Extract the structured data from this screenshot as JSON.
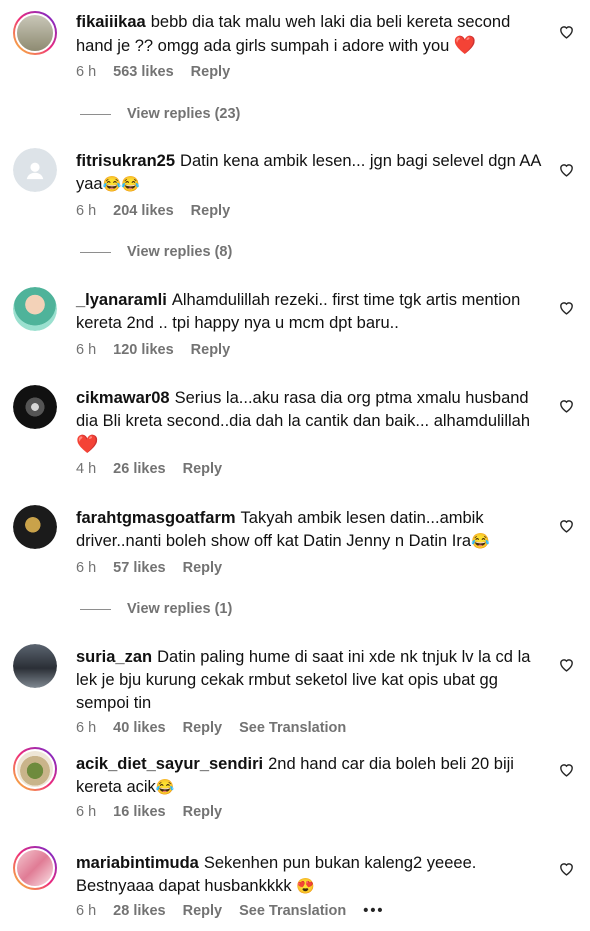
{
  "comments": [
    {
      "username": "fikaiiikaa",
      "text": "bebb dia tak malu weh laki dia beli kereta second hand je ?? omgg ada girls sumpah i adore with you",
      "emoji": "❤️",
      "time": "6 h",
      "likes": "563 likes",
      "reply": "Reply",
      "view_replies": "View replies (23)"
    },
    {
      "username": "fitrisukran25",
      "text": "Datin kena ambik lesen... jgn bagi selevel dgn AA yaa",
      "emoji": "😂😂",
      "time": "6 h",
      "likes": "204 likes",
      "reply": "Reply",
      "view_replies": "View replies (8)"
    },
    {
      "username": "_lyanaramli",
      "text": "Alhamdulillah rezeki.. first time tgk artis mention kereta 2nd .. tpi happy nya u mcm dpt baru..",
      "time": "6 h",
      "likes": "120 likes",
      "reply": "Reply"
    },
    {
      "username": "cikmawar08",
      "text": "Serius la...aku rasa dia org ptma xmalu husband dia Bli kreta second..dia dah la cantik dan baik... alhamdulillah",
      "emoji": "❤️",
      "time": "4 h",
      "likes": "26 likes",
      "reply": "Reply"
    },
    {
      "username": "farahtgmasgoatfarm",
      "text": "Takyah ambik lesen datin...ambik driver..nanti boleh show off kat Datin Jenny n Datin Ira",
      "emoji": "😂",
      "time": "6 h",
      "likes": "57 likes",
      "reply": "Reply",
      "view_replies": "View replies (1)"
    },
    {
      "username": "suria_zan",
      "text": "Datin paling hume di saat ini xde nk tnjuk lv la cd la lek je bju kurung cekak rmbut seketol live kat opis ubat gg sempoi tin",
      "time": "6 h",
      "likes": "40 likes",
      "reply": "Reply",
      "see_translation": "See Translation"
    },
    {
      "username": "acik_diet_sayur_sendiri",
      "text": "2nd hand car dia boleh beli 20 biji kereta acik",
      "emoji": "😂",
      "time": "6 h",
      "likes": "16 likes",
      "reply": "Reply"
    },
    {
      "username": "mariabintimuda",
      "text": "Sekenhen pun bukan kaleng2 yeeee. Bestnyaaa dapat husbankkkk",
      "emoji": "😍",
      "time": "6 h",
      "likes": "28 likes",
      "reply": "Reply",
      "see_translation": "See Translation",
      "more": "•••"
    }
  ],
  "icons": {
    "like": "heart-outline-icon"
  },
  "colors": {
    "meta": "#737373",
    "heart_red": "#e0245e",
    "story_ring": "#ee2a7b"
  }
}
